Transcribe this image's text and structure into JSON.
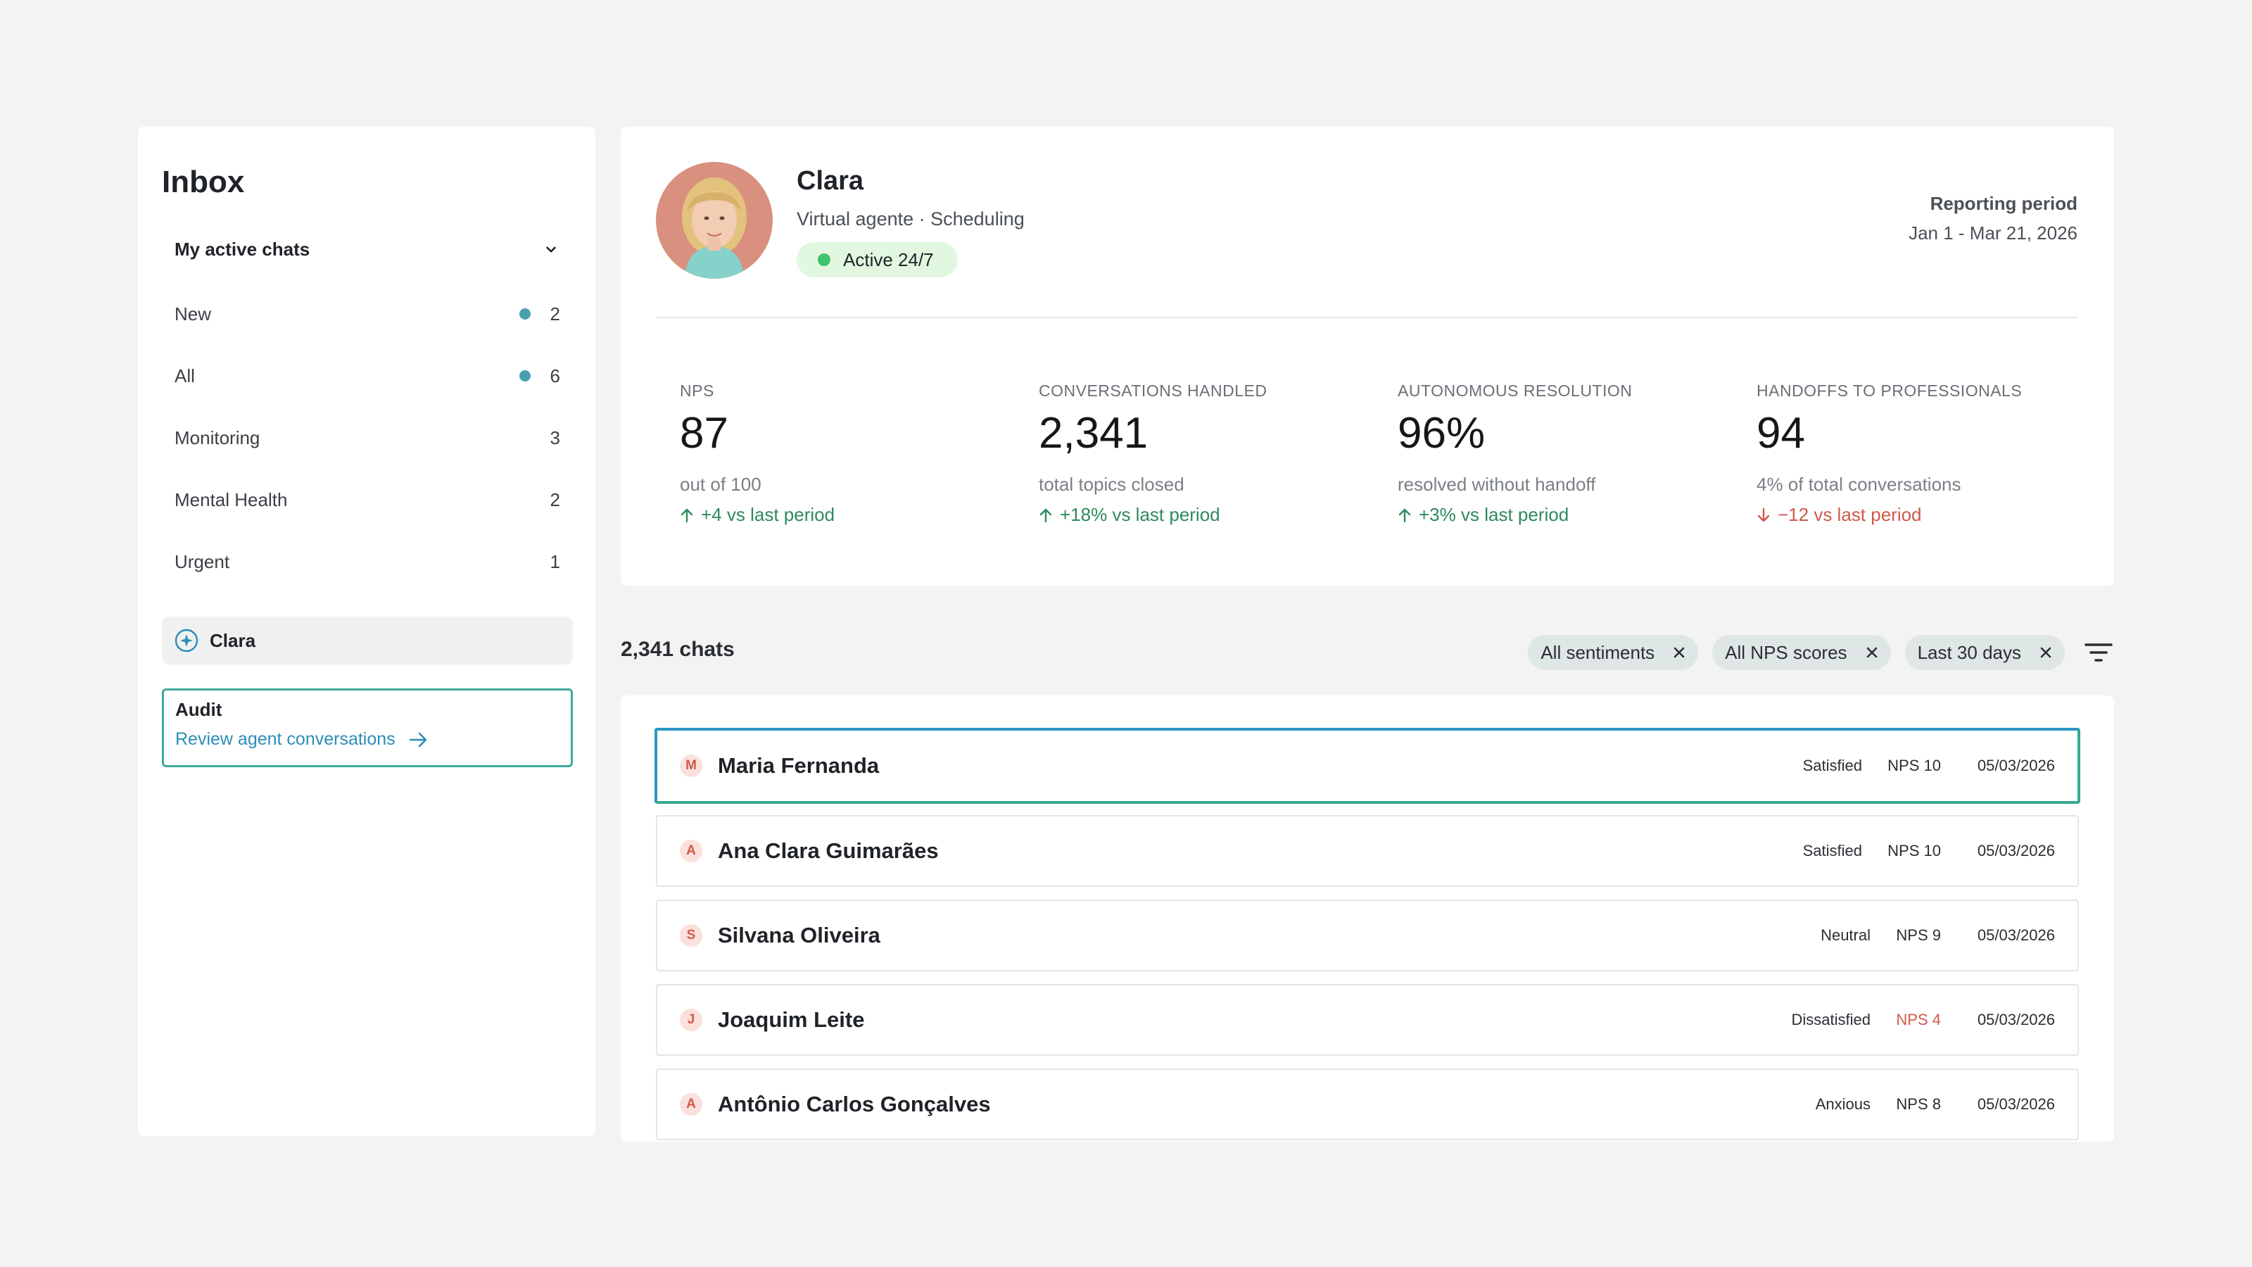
{
  "sidebar": {
    "title": "Inbox",
    "section_label": "My active chats",
    "items": [
      {
        "label": "New",
        "count": "2",
        "dot": true
      },
      {
        "label": "All",
        "count": "6",
        "dot": true
      },
      {
        "label": "Monitoring",
        "count": "3",
        "dot": false
      },
      {
        "label": "Mental Health",
        "count": "2",
        "dot": false
      },
      {
        "label": "Urgent",
        "count": "1",
        "dot": false
      }
    ],
    "agent_item": "Clara",
    "audit": {
      "title": "Audit",
      "link": "Review agent conversations"
    }
  },
  "agent": {
    "name": "Clara",
    "role": "Virtual agente · Scheduling",
    "status": "Active 24/7",
    "period_label": "Reporting period",
    "period_value": "Jan 1 - Mar 21, 2026"
  },
  "metrics": [
    {
      "label": "NPS",
      "value": "87",
      "sub": "out of 100",
      "delta": "+4 vs last period",
      "direction": "up"
    },
    {
      "label": "CONVERSATIONS HANDLED",
      "value": "2,341",
      "sub": "total topics closed",
      "delta": "+18% vs last period",
      "direction": "up"
    },
    {
      "label": "AUTONOMOUS RESOLUTION",
      "value": "96%",
      "sub": "resolved without handoff",
      "delta": "+3% vs last period",
      "direction": "up"
    },
    {
      "label": "HANDOFFS TO PROFESSIONALS",
      "value": "94",
      "sub": "4% of total conversations",
      "delta": "−12 vs last period",
      "direction": "down"
    }
  ],
  "chats": {
    "count_label": "2,341 chats",
    "filters": [
      "All sentiments",
      "All NPS scores",
      "Last 30 days"
    ],
    "rows": [
      {
        "initial": "M",
        "name": "Maria Fernanda",
        "sentiment": "Satisfied",
        "nps": "NPS 10",
        "date": "05/03/2026",
        "low": false,
        "selected": true
      },
      {
        "initial": "A",
        "name": "Ana Clara Guimarães",
        "sentiment": "Satisfied",
        "nps": "NPS 10",
        "date": "05/03/2026",
        "low": false,
        "selected": false
      },
      {
        "initial": "S",
        "name": "Silvana Oliveira",
        "sentiment": "Neutral",
        "nps": "NPS 9",
        "date": "05/03/2026",
        "low": false,
        "selected": false
      },
      {
        "initial": "J",
        "name": "Joaquim Leite",
        "sentiment": "Dissatisfied",
        "nps": "NPS 4",
        "date": "05/03/2026",
        "low": true,
        "selected": false
      },
      {
        "initial": "A",
        "name": "Antônio Carlos Gonçalves",
        "sentiment": "Anxious",
        "nps": "NPS 8",
        "date": "05/03/2026",
        "low": false,
        "selected": false
      }
    ]
  },
  "colors": {
    "accent_teal": "#4a9fae",
    "positive": "#2f8a5b",
    "negative": "#cf5a4a",
    "link": "#2b8eb8",
    "status_green": "#3fc46c"
  },
  "icons": {
    "chevron": "chevron-down-icon",
    "agent": "sparkle-icon",
    "arrow": "arrow-right-icon",
    "filter": "filter-icon",
    "close": "close-icon"
  }
}
